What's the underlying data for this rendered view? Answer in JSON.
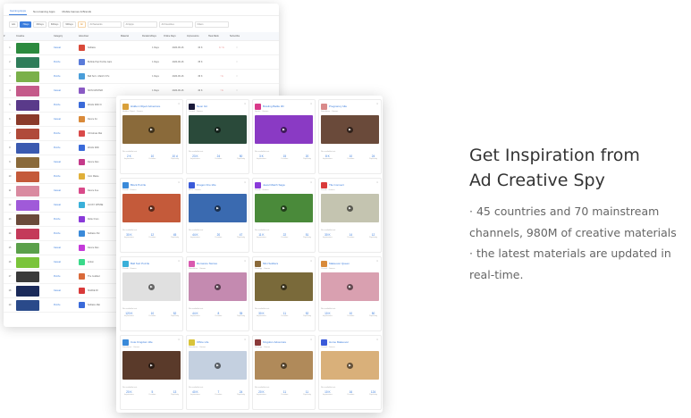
{
  "table_panel": {
    "tabs": [
      {
        "label": "Gaming Apps",
        "active": true
      },
      {
        "label": "Non-Gaming Apps",
        "active": false
      },
      {
        "label": "Mobile Games & Brands",
        "active": false
      }
    ],
    "filters": [
      {
        "label": "Ads",
        "state": "normal"
      },
      {
        "label": "7Days",
        "state": "active"
      },
      {
        "label": "30Days",
        "state": "normal"
      },
      {
        "label": "60Days",
        "state": "normal"
      },
      {
        "label": "90Days",
        "state": "normal"
      },
      {
        "label": "All",
        "state": "warn"
      }
    ],
    "selects": [
      "All Networks",
      "All Apps",
      "All Countries",
      "Filters"
    ],
    "headers": [
      "#",
      "Creative",
      "Category",
      "Advertiser",
      "Material",
      "Duration/Days",
      "Online Days",
      "Impressions",
      "Heat Rank",
      "Subscribe"
    ],
    "rows": [
      {
        "idx": "1",
        "cat": "Casual",
        "app": "Solitaire",
        "mat": "",
        "dur": "1 Days",
        "date": "2020-06-16",
        "imp": "34 K",
        "pop": "1 ↑ 1",
        "thumb": "#2c8a3e",
        "icon": "#d94a3a"
      },
      {
        "idx": "2",
        "cat": "Puzzle",
        "app": "Bubble Pop Puzzle Gam",
        "mat": "",
        "dur": "1 Days",
        "date": "2020-06-16",
        "imp": "35 K",
        "pop": "",
        "thumb": "#2f7d5a",
        "icon": "#5a7bd9"
      },
      {
        "idx": "3",
        "cat": "Puzzle",
        "app": "Ball Sort - Match 3 Pu",
        "mat": "",
        "dur": "1 Days",
        "date": "2020-06-16",
        "imp": "36 K",
        "pop": "↑ 1",
        "thumb": "#7ab04a",
        "icon": "#4a9ed9"
      },
      {
        "idx": "4",
        "cat": "Casual",
        "app": "SKIN MASTER",
        "mat": "",
        "dur": "1 Days",
        "date": "2020-06-16",
        "imp": "40 K",
        "pop": "↑ 1",
        "thumb": "#c45a8a",
        "icon": "#8a5ac4"
      },
      {
        "idx": "5",
        "cat": "Puzzle",
        "app": "Words With Fr",
        "mat": "",
        "dur": "1 Days",
        "date": "2020-06-16",
        "imp": "41 K",
        "pop": "",
        "thumb": "#5a3a8a",
        "icon": "#3a6ad9"
      },
      {
        "idx": "6",
        "cat": "Casual",
        "app": "Dance Fo",
        "mat": "",
        "dur": "1 Days",
        "date": "2020-06-16",
        "imp": "33 K",
        "pop": "",
        "thumb": "#8a3a2a",
        "icon": "#d98a3a"
      },
      {
        "idx": "7",
        "cat": "Puzzle",
        "app": "Christmas Mat",
        "mat": "",
        "dur": "1 Days",
        "date": "2020-06-16",
        "imp": "30 K",
        "pop": "",
        "thumb": "#b04a3a",
        "icon": "#d94a4a"
      },
      {
        "idx": "8",
        "cat": "Puzzle",
        "app": "Words With",
        "mat": "",
        "dur": "1 Days",
        "date": "2020-06-16",
        "imp": "29 K",
        "pop": "",
        "thumb": "#3a5ab0",
        "icon": "#3a6ad9"
      },
      {
        "idx": "9",
        "cat": "Casual",
        "app": "Dance Dan",
        "mat": "",
        "dur": "1 Days",
        "date": "2020-06-16",
        "imp": "27 K",
        "pop": "",
        "thumb": "#8a6a3a",
        "icon": "#c43a8a"
      },
      {
        "idx": "10",
        "cat": "Puzzle",
        "app": "Coin Maste",
        "mat": "",
        "dur": "1 Days",
        "date": "2020-06-16",
        "imp": "25 K",
        "pop": "",
        "thumb": "#c45a3a",
        "icon": "#e0b03a"
      },
      {
        "idx": "11",
        "cat": "Casual",
        "app": "Dance Fee",
        "mat": "",
        "dur": "1 Days",
        "date": "2020-06-16",
        "imp": "24 K",
        "pop": "",
        "thumb": "#d98aa0",
        "icon": "#d94a8a"
      },
      {
        "idx": "12",
        "cat": "Casual",
        "app": "LUCKY WINNE",
        "mat": "",
        "dur": "1 Days",
        "date": "2020-06-16",
        "imp": "22 K",
        "pop": "",
        "thumb": "#a05ad9",
        "icon": "#3ab0d9"
      },
      {
        "idx": "13",
        "cat": "Puzzle",
        "app": "Roller Fran",
        "mat": "",
        "dur": "1 Days",
        "date": "2020-06-16",
        "imp": "21 K",
        "pop": "",
        "thumb": "#6a4a3a",
        "icon": "#8a3ad9"
      },
      {
        "idx": "14",
        "cat": "Puzzle",
        "app": "Solitaire Pal",
        "mat": "",
        "dur": "1 Days",
        "date": "2020-06-16",
        "imp": "20 K",
        "pop": "",
        "thumb": "#c43a5a",
        "icon": "#3a8ad9"
      },
      {
        "idx": "15",
        "cat": "Casual",
        "app": "Dance Dan",
        "mat": "",
        "dur": "1 Days",
        "date": "2020-06-16",
        "imp": "19 K",
        "pop": "",
        "thumb": "#5aa04a",
        "icon": "#c43ad9"
      },
      {
        "idx": "16",
        "cat": "Casual",
        "app": "Action",
        "mat": "",
        "dur": "1 Days",
        "date": "2020-06-16",
        "imp": "18 K",
        "pop": "",
        "thumb": "#7ac43a",
        "icon": "#3ad98a"
      },
      {
        "idx": "17",
        "cat": "Puzzle",
        "app": "The Guilded",
        "mat": "",
        "dur": "1 Days",
        "date": "2020-06-16",
        "imp": "17 K",
        "pop": "",
        "thumb": "#3a3a3a",
        "icon": "#d96a3a"
      },
      {
        "idx": "18",
        "cat": "Casual",
        "app": "SNAKE RI",
        "mat": "",
        "dur": "1 Days",
        "date": "2020-06-16",
        "imp": "16 K",
        "pop": "",
        "thumb": "#1a2a5a",
        "icon": "#d93a3a"
      },
      {
        "idx": "19",
        "cat": "Puzzle",
        "app": "Solitaire Mat",
        "mat": "",
        "dur": "1 Days",
        "date": "2020-06-16",
        "imp": "15 K",
        "pop": "",
        "thumb": "#2a4a8a",
        "icon": "#3a6ad9"
      }
    ]
  },
  "grid_panel": {
    "cards": [
      {
        "title": "Hidden Object Adventure",
        "sub": "Hidden Object · Games",
        "icon": "#d9a03a",
        "media": "#8a6a3a",
        "stats": [
          "2 K",
          "10",
          "10 d"
        ]
      },
      {
        "title": "Neon Git",
        "sub": "Casual · Games",
        "icon": "#1a1a3a",
        "media": "#2a4a3a",
        "stats": [
          "23 K",
          "24",
          "50"
        ]
      },
      {
        "title": "Bowling Battle 3D",
        "sub": "Sports · Games",
        "icon": "#d93a8a",
        "media": "#8a3ac4",
        "stats": [
          "3 K",
          "15",
          "20"
        ]
      },
      {
        "title": "Pregnancy Idle",
        "sub": "Simulation · Games",
        "icon": "#d98a8a",
        "media": "#6a4a3a",
        "stats": [
          "8 K",
          "10",
          "24"
        ]
      },
      {
        "title": "Block Puzzle",
        "sub": "Puzzle · Games",
        "icon": "#3a8ad9",
        "media": "#c45a3a",
        "stats": [
          "30 K",
          "12",
          "45"
        ]
      },
      {
        "title": "Dragon Fire Idle",
        "sub": "RPG · Games",
        "icon": "#3a5ad9",
        "media": "#3a6ab0",
        "stats": [
          "44 K",
          "20",
          "47"
        ]
      },
      {
        "title": "Jewel Match Saga",
        "sub": "Puzzle · Games",
        "icon": "#8a3ad9",
        "media": "#4a8a3a",
        "stats": [
          "11 K",
          "22",
          "51"
        ]
      },
      {
        "title": "Tile Connect",
        "sub": "Puzzle · Games",
        "icon": "#d93a3a",
        "media": "#c4c4b0",
        "stats": [
          "30 K",
          "14",
          "12"
        ]
      },
      {
        "title": "Ball Sort Puzzle",
        "sub": "Puzzle · Games",
        "icon": "#3ab0d9",
        "media": "#e0e0e0",
        "stats": [
          "120 K",
          "10",
          "52"
        ]
      },
      {
        "title": "Romance Stories",
        "sub": "Simulation · Games",
        "icon": "#d95ab0",
        "media": "#c48ab0",
        "stats": [
          "44 K",
          "8",
          "35"
        ]
      },
      {
        "title": "Mini Soldiers",
        "sub": "Strategy · Games",
        "icon": "#8a6a3a",
        "media": "#7a6a3a",
        "stats": [
          "30 K",
          "11",
          "52"
        ]
      },
      {
        "title": "Makeover Queen",
        "sub": "Casual · Games",
        "icon": "#d98a3a",
        "media": "#d9a0b0",
        "stats": [
          "10 K",
          "10",
          "50"
        ]
      },
      {
        "title": "Cute Kingdom Idle",
        "sub": "Simulation · Games",
        "icon": "#3a8ad9",
        "media": "#5a3a2a",
        "stats": [
          "20 K",
          "5",
          "13"
        ]
      },
      {
        "title": "Office Life",
        "sub": "Simulation · Games",
        "icon": "#d9c43a",
        "media": "#c4d0e0",
        "stats": [
          "40 K",
          "7",
          "24"
        ]
      },
      {
        "title": "Kingdom Adventure",
        "sub": "Strategy · Games",
        "icon": "#8a3a3a",
        "media": "#b08a5a",
        "stats": [
          "20 K",
          "11",
          "11"
        ]
      },
      {
        "title": "Home Makeover",
        "sub": "Casual · Games",
        "icon": "#3a5ad9",
        "media": "#d9b07a",
        "stats": [
          "10 K",
          "16",
          "124"
        ]
      }
    ],
    "note": "No available text",
    "stat_labels": [
      "Impressions",
      "Duration",
      "Popularity"
    ]
  },
  "promo": {
    "title": "Get Inspiration from Ad Creative Spy",
    "line1": "· 45 countries and 70 mainstream channels, 980M of creative materials",
    "line2": "· the latest materials are updated in real-time."
  }
}
